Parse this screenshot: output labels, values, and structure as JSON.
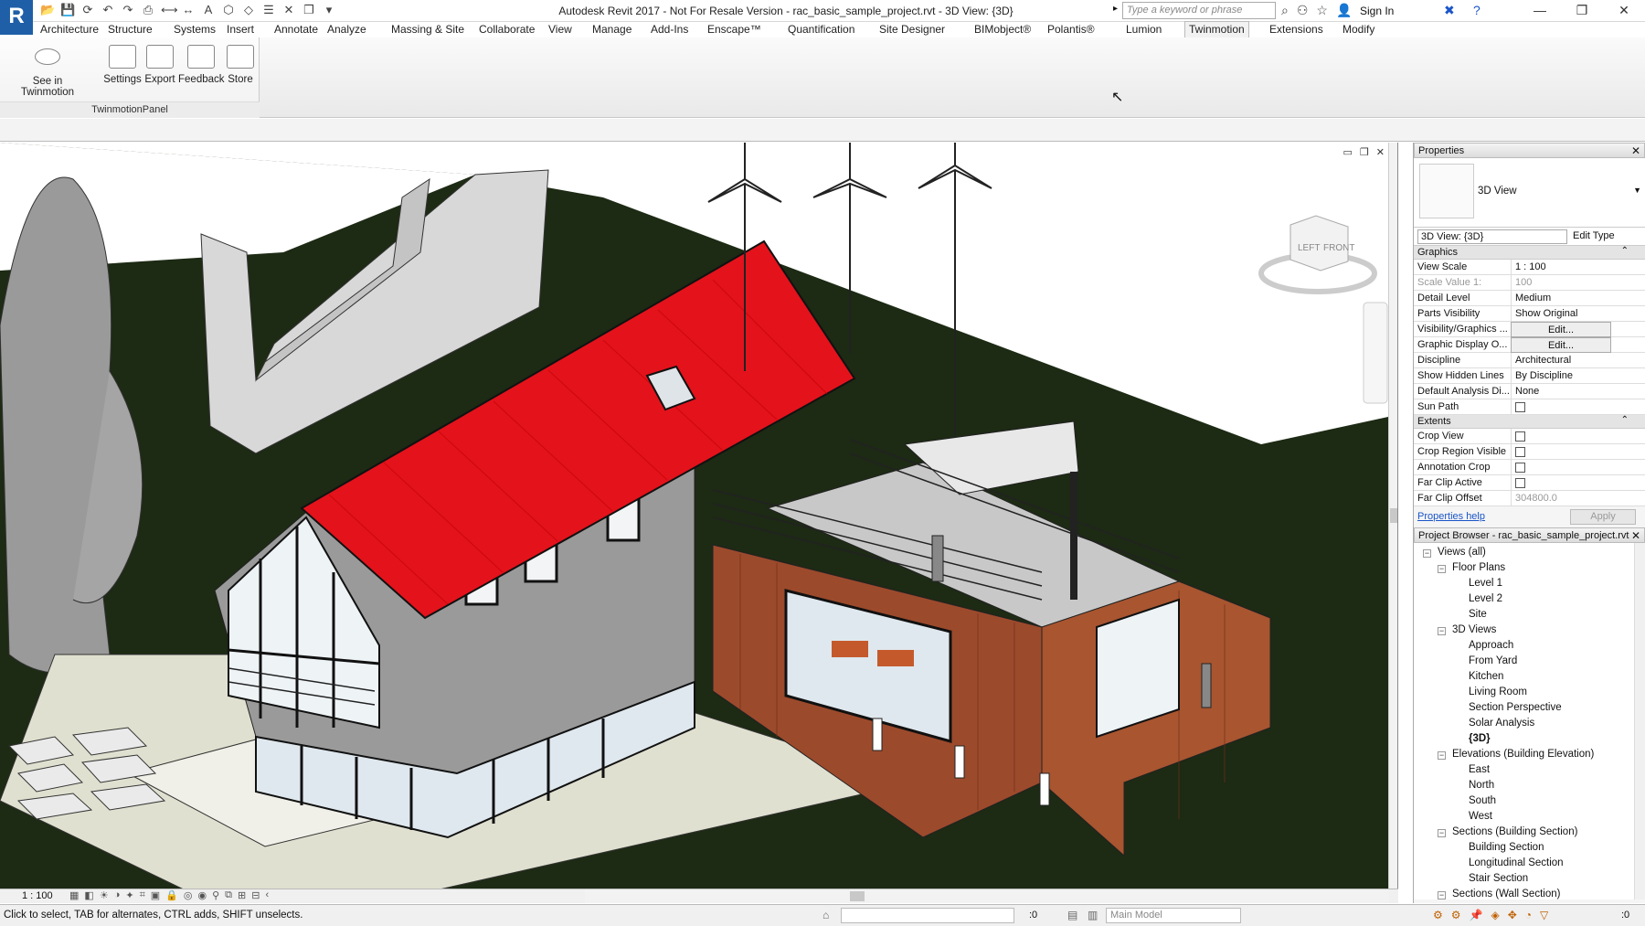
{
  "app": {
    "logo": "R",
    "title": "Autodesk Revit 2017 - Not For Resale Version -     rac_basic_sample_project.rvt - 3D View: {3D}",
    "search_placeholder": "Type a keyword or phrase",
    "sign_in": "Sign In"
  },
  "tabs": [
    "Architecture",
    "Structure",
    "Systems",
    "Insert",
    "Annotate",
    "Analyze",
    "Massing & Site",
    "Collaborate",
    "View",
    "Manage",
    "Add-Ins",
    "Enscape™",
    "Quantification",
    "Site Designer",
    "BIMobject®",
    "Polantis®",
    "Lumion",
    "Twinmotion",
    "Extensions",
    "Modify"
  ],
  "active_tab": "Twinmotion",
  "ribbon": {
    "buttons": [
      "See in Twinmotion",
      "Settings",
      "Export",
      "Feedback",
      "Store"
    ],
    "panel_label": "TwinmotionPanel"
  },
  "viewcube": {
    "left": "LEFT",
    "front": "FRONT"
  },
  "properties": {
    "header": "Properties",
    "type_label": "3D View",
    "view_selector": "3D View: {3D}",
    "edit_type": "Edit Type",
    "groups": [
      {
        "name": "Graphics",
        "rows": [
          {
            "k": "View Scale",
            "v": "1 : 100"
          },
          {
            "k": "Scale Value    1:",
            "v": "100"
          },
          {
            "k": "Detail Level",
            "v": "Medium"
          },
          {
            "k": "Parts Visibility",
            "v": "Show Original"
          },
          {
            "k": "Visibility/Graphics ...",
            "v": "Edit..."
          },
          {
            "k": "Graphic Display O...",
            "v": "Edit..."
          },
          {
            "k": "Discipline",
            "v": "Architectural"
          },
          {
            "k": "Show Hidden Lines",
            "v": "By Discipline"
          },
          {
            "k": "Default Analysis Di...",
            "v": "None"
          },
          {
            "k": "Sun Path",
            "v": ""
          }
        ]
      },
      {
        "name": "Extents",
        "rows": [
          {
            "k": "Crop View",
            "v": ""
          },
          {
            "k": "Crop Region Visible",
            "v": ""
          },
          {
            "k": "Annotation Crop",
            "v": ""
          },
          {
            "k": "Far Clip Active",
            "v": ""
          },
          {
            "k": "Far Clip Offset",
            "v": "304800.0"
          }
        ]
      }
    ],
    "help": "Properties help",
    "apply": "Apply"
  },
  "project_browser": {
    "header": "Project Browser - rac_basic_sample_project.rvt",
    "root": "Views (all)",
    "floor_plans": "Floor Plans",
    "floor_items": [
      "Level 1",
      "Level 2",
      "Site"
    ],
    "views3d": "3D Views",
    "views3d_items": [
      "Approach",
      "From Yard",
      "Kitchen",
      "Living Room",
      "Section Perspective",
      "Solar Analysis",
      "{3D}"
    ],
    "elevations": "Elevations (Building Elevation)",
    "elev_items": [
      "East",
      "North",
      "South",
      "West"
    ],
    "sections_bldg": "Sections (Building Section)",
    "section_items": [
      "Building Section",
      "Longitudinal Section",
      "Stair Section"
    ],
    "sections_wall": "Sections (Wall Section)"
  },
  "view_bar": {
    "scale": "1 : 100"
  },
  "status": {
    "text": "Click to select, TAB for alternates, CTRL adds, SHIFT unselects.",
    "zero": ":0",
    "model": "Main Model",
    "filter_zero": ":0"
  },
  "colors": {
    "roof": "#e4121b",
    "ground": "#1d2a14",
    "cladding": "#9c4a2c",
    "wall": "#9a9a9a"
  }
}
